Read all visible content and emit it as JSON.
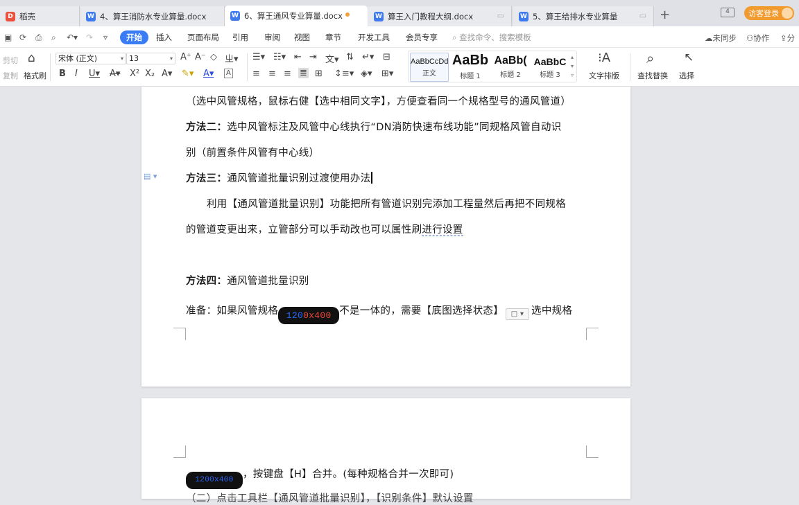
{
  "tabs": [
    {
      "label": "稻壳",
      "icon": "D",
      "color": "#e8533f"
    },
    {
      "label": "4、算王消防水专业算量.docx",
      "icon": "W",
      "color": "#3f7bee"
    },
    {
      "label": "6、算王通风专业算量.docx",
      "icon": "W",
      "color": "#3f7bee"
    },
    {
      "label": "算王入门教程大纲.docx",
      "icon": "W",
      "color": "#3f7bee"
    },
    {
      "label": "5、算王给排水专业算量",
      "icon": "W",
      "color": "#3f7bee"
    }
  ],
  "window_badge": "4",
  "login_label": "访客登录",
  "menu": [
    "开始",
    "插入",
    "页面布局",
    "引用",
    "审阅",
    "视图",
    "章节",
    "开发工具",
    "会员专享"
  ],
  "search_placeholder": "查找命令、搜索模板",
  "sync_status": "未同步",
  "collab": "协作",
  "share": "分",
  "ribbon": {
    "cut": "剪切",
    "copy": "复制",
    "format_painter": "格式刷",
    "font_name": "宋体 (正文)",
    "font_size": "13",
    "styles": [
      {
        "preview": "AaBbCcDd",
        "name": "正文"
      },
      {
        "preview": "AaBb",
        "name": "标题 1"
      },
      {
        "preview": "AaBb(",
        "name": "标题 2"
      },
      {
        "preview": "AaBbC",
        "name": "标题 3"
      }
    ],
    "text_layout": "文字排版",
    "find_replace": "查找替换",
    "select": "选择"
  },
  "doc": {
    "l1": "（选中风管规格，鼠标右健【选中相同文字】，方便查看同一个规格型号的通风管道）",
    "l2_b": "方法二：",
    "l2": "选中风管标注及风管中心线执行“DN消防快速布线功能”同规格风管自动识",
    "l3": "别（前置条件风管有中心线）",
    "l4_b": "方法三：",
    "l4": "通风管道批量识别过渡使用办法",
    "l5": "利用【通风管道批量识别】功能把所有管道识别完添加工程量然后再把不同规格",
    "l6a": "的管道变更出来，立管部分可以手动改也可以属性刷",
    "l6b": "进行设置",
    "l7_b": "方法四：",
    "l7": "通风管道批量识别",
    "l8a": "准备：如果风管规格",
    "pill1_a": "120",
    "pill1_b": "0x400",
    "l8b": "不是一体的，需要【底图选择状态】",
    "chip": "□ ▾",
    "l8c": "选中规格",
    "pill2": "1200x400",
    "l9": "，按键盘【H】合并。(每种规格合并一次即可)",
    "l10": "（二）点击工具栏【通风管道批量识别】，【识别条件】默认设置"
  }
}
